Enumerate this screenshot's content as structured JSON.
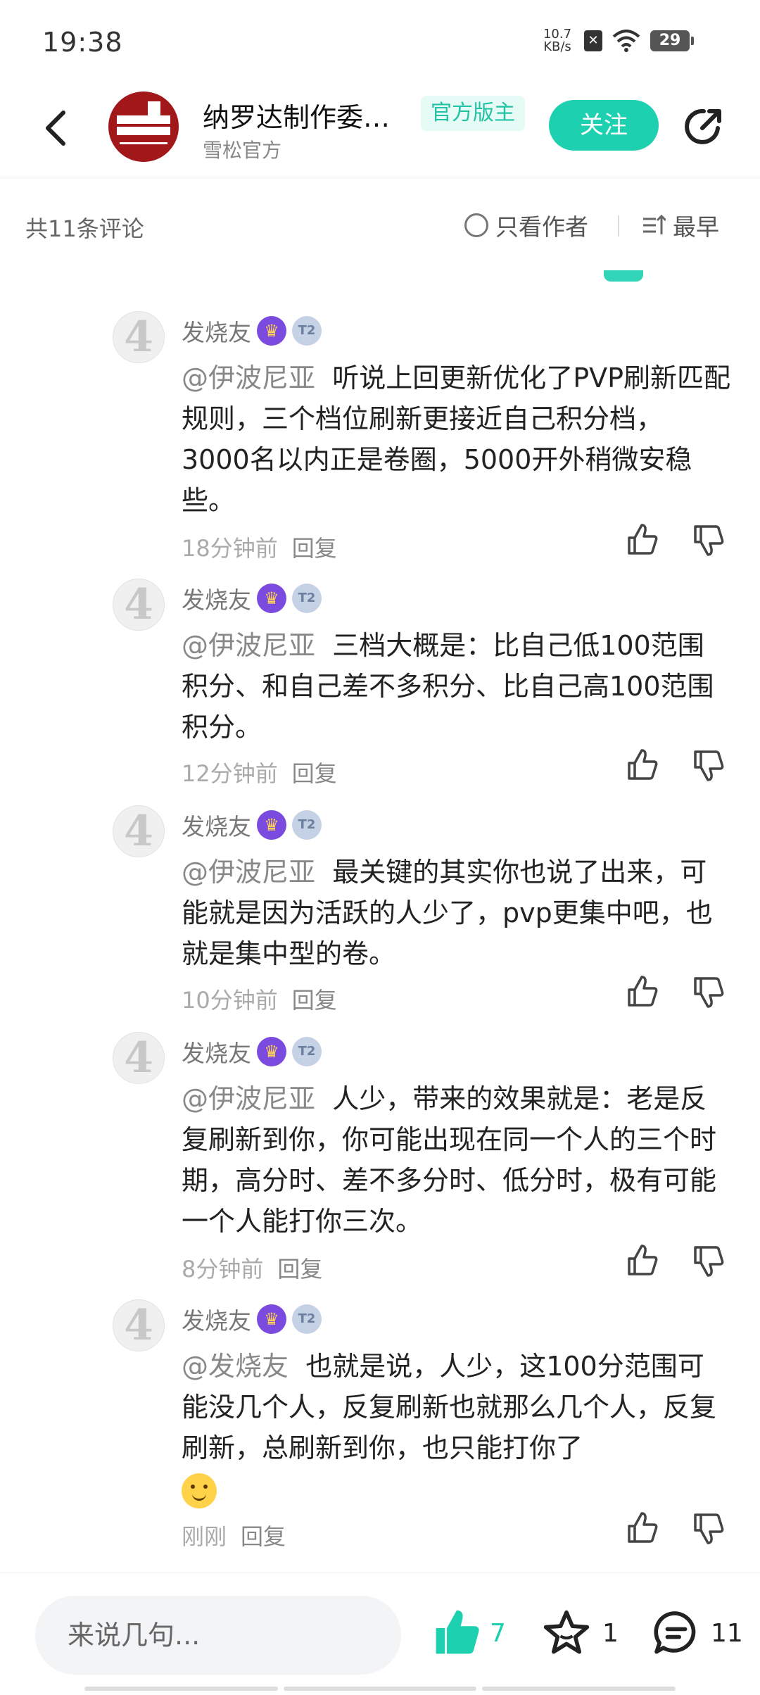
{
  "status_bar": {
    "time": "19:38",
    "net_speed_value": "10.7",
    "net_speed_unit": "KB/s",
    "battery": "29"
  },
  "header": {
    "author_name": "纳罗达制作委…",
    "official_badge": "官方版主",
    "author_sub": "雪松官方",
    "follow_label": "关注"
  },
  "filter": {
    "comment_count": "共11条评论",
    "only_author": "只看作者",
    "sort": "最早"
  },
  "comments": [
    {
      "name": "发烧友",
      "mention": "@伊波尼亚",
      "text": "听说上回更新优化了PVP刷新匹配规则，三个档位刷新更接近自己积分档，3000名以内正是卷圈，5000开外稍微安稳些。",
      "time": "18分钟前",
      "reply": "回复"
    },
    {
      "name": "发烧友",
      "mention": "@伊波尼亚",
      "text": "三档大概是：比自己低100范围积分、和自己差不多积分、比自己高100范围积分。",
      "time": "12分钟前",
      "reply": "回复"
    },
    {
      "name": "发烧友",
      "mention": "@伊波尼亚",
      "text": "最关键的其实你也说了出来，可能就是因为活跃的人少了，pvp更集中吧，也就是集中型的卷。",
      "time": "10分钟前",
      "reply": "回复"
    },
    {
      "name": "发烧友",
      "mention": "@伊波尼亚",
      "text": "人少，带来的效果就是：老是反复刷新到你，你可能出现在同一个人的三个时期，高分时、差不多分时、低分时，极有可能一个人能打你三次。",
      "time": "8分钟前",
      "reply": "回复"
    },
    {
      "name": "发烧友",
      "mention": "@发烧友",
      "text": "也就是说，人少，这100分范围可能没几个人，反复刷新也就那么几个人，反复刷新，总刷新到你，也只能打你了",
      "time": "刚刚",
      "reply": "回复"
    }
  ],
  "bottom_bar": {
    "input_placeholder": "来说几句...",
    "like_count": "7",
    "star_count": "1",
    "comment_count": "11",
    "accent": "#1dd0b0"
  }
}
